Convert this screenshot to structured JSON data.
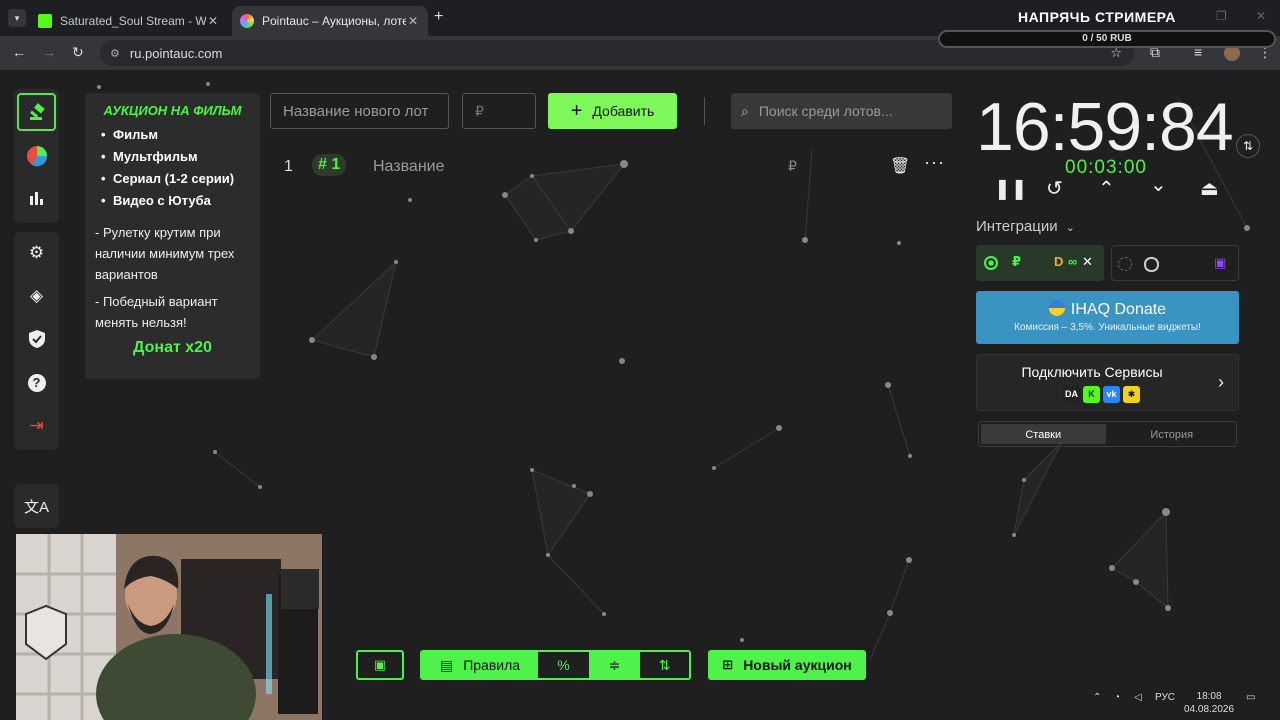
{
  "browser": {
    "tabs": [
      {
        "title": "Saturated_Soul Stream - Watch",
        "active": false,
        "favicon_color": "#53fc18"
      },
      {
        "title": "Pointauc – Аукционы, лотереи",
        "active": true,
        "favicon_color": "#c86cff"
      }
    ],
    "url": "ru.pointauc.com"
  },
  "overlay": {
    "streamer_title": "НАПРЯЧЬ СТРИМЕРА",
    "donate_goal": "0 / 50 RUB"
  },
  "info_card": {
    "title": "АУКЦИОН НА ФИЛЬМ",
    "items": [
      "Фильм",
      "Мультфильм",
      "Сериал (1-2 серии)",
      "Видео с Ютуба"
    ],
    "notes": [
      "- Рулетку крутим при наличии минимум трех вариантов",
      "- Победный вариант менять нельзя!"
    ],
    "donate": "Донат x20"
  },
  "lot_form": {
    "name_placeholder": "Название нового лот",
    "price_placeholder": "₽",
    "add_label": "Добавить",
    "search_placeholder": "Поиск среди лотов..."
  },
  "lots": [
    {
      "index": "1",
      "badge": "# 1",
      "name": "Название",
      "currency": "₽"
    }
  ],
  "timer": {
    "clock": "16:59:84",
    "sub": "00:03:00"
  },
  "integrations": {
    "label": "Интеграции",
    "ihaq_title": "IHAQ Donate",
    "ihaq_sub": "Комиссия – 3,5%. Уникальные виджеты!",
    "services_title": "Подключить Сервисы"
  },
  "history_tabs": [
    "Ставки",
    "История"
  ],
  "bottom": {
    "rules_label": "Правила",
    "percent_label": "%",
    "new_auction_label": "Новый аукцион"
  },
  "taskbar": {
    "lang": "РУС",
    "time": "18:08",
    "date": "04.08.2026"
  },
  "colors": {
    "accent_green": "#4ef24a",
    "add_button": "#7ef75a",
    "ihaq_blue": "#3b93c1"
  }
}
